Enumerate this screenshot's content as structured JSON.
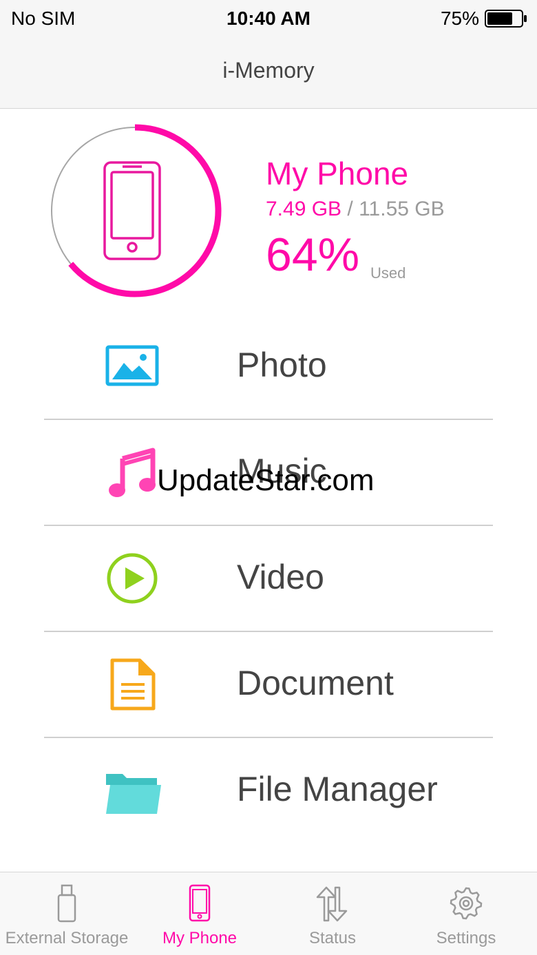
{
  "status_bar": {
    "carrier": "No SIM",
    "time": "10:40 AM",
    "battery": "75%",
    "battery_level": 0.75
  },
  "nav": {
    "title": "i-Memory"
  },
  "storage": {
    "name": "My Phone",
    "used": "7.49 GB",
    "separator": " / ",
    "total": "11.55 GB",
    "percent": "64%",
    "percent_label": "Used",
    "used_fraction": 0.64,
    "accent_color": "#ff0aa8",
    "icon": "phone-icon"
  },
  "menu": [
    {
      "label": "Photo",
      "icon": "photo-icon",
      "color": "#1ab2e8"
    },
    {
      "label": "Music",
      "icon": "music-note-icon",
      "color": "#ff44b4"
    },
    {
      "label": "Video",
      "icon": "play-circle-icon",
      "color": "#8fd11e"
    },
    {
      "label": "Document",
      "icon": "document-icon",
      "color": "#f7a81b"
    },
    {
      "label": "File Manager",
      "icon": "folder-icon",
      "color": "#4fd3d3"
    }
  ],
  "watermark": "UpdateStar.com",
  "tabs": [
    {
      "label": "External Storage",
      "icon": "usb-drive-icon",
      "active": false
    },
    {
      "label": "My Phone",
      "icon": "phone-icon",
      "active": true
    },
    {
      "label": "Status",
      "icon": "transfer-arrows-icon",
      "active": false
    },
    {
      "label": "Settings",
      "icon": "gear-icon",
      "active": false
    }
  ]
}
